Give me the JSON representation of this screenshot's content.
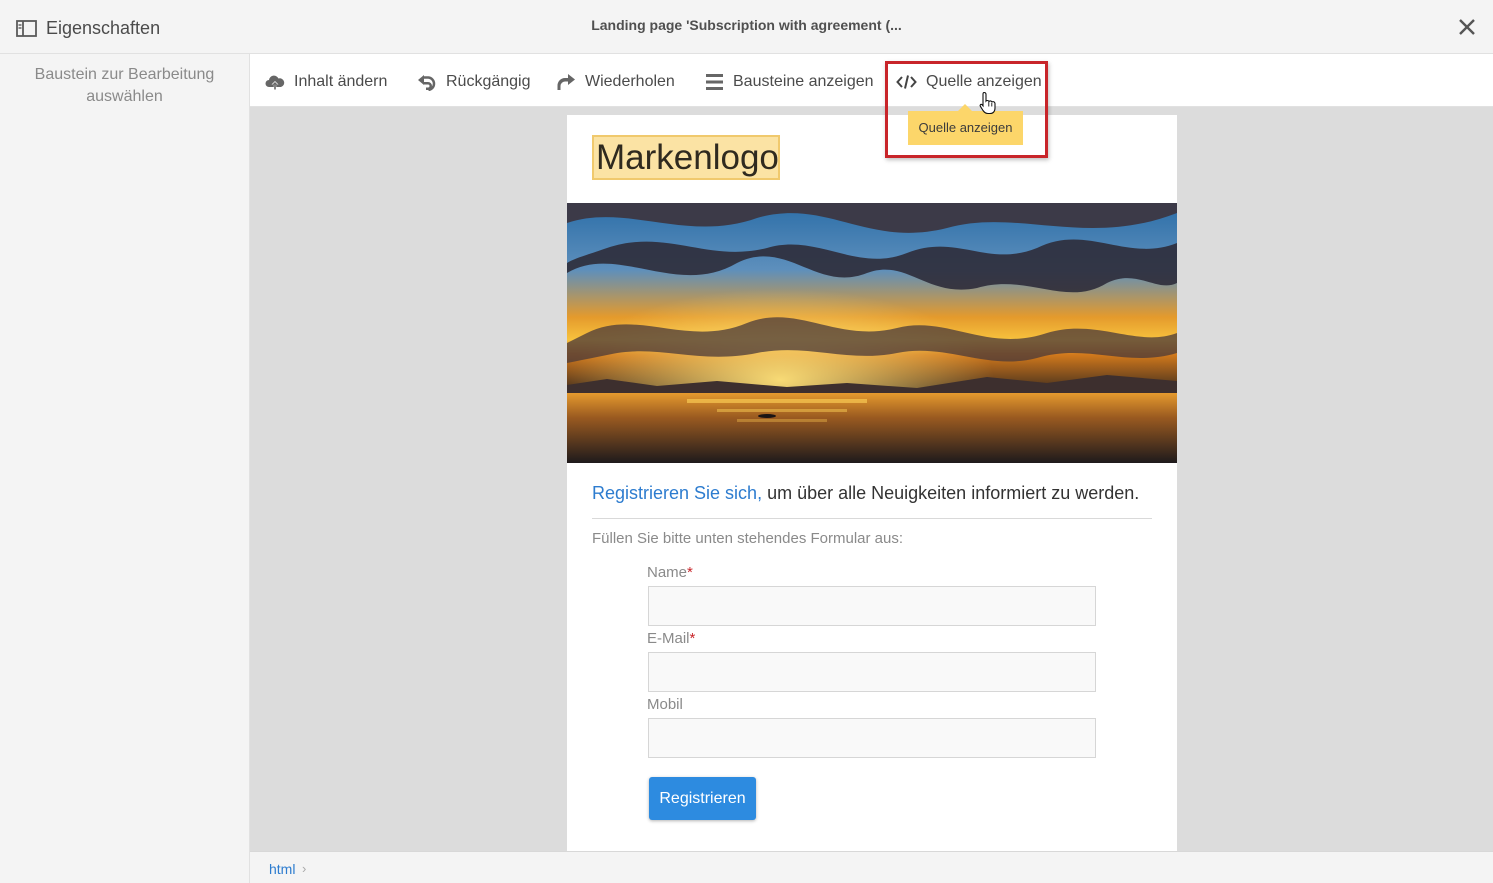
{
  "header": {
    "properties_label": "Eigenschaften",
    "window_title": "Landing page 'Subscription with agreement (..."
  },
  "left_panel": {
    "hint": "Baustein zur Bearbeitung auswählen"
  },
  "toolbar": {
    "change_content": "Inhalt ändern",
    "undo": "Rückgängig",
    "redo": "Wiederholen",
    "show_blocks": "Bausteine anzeigen",
    "show_source": "Quelle anzeigen",
    "tooltip": "Quelle anzeigen"
  },
  "page": {
    "logo": "Markenlogo",
    "headline_accent": "Registrieren Sie sich,",
    "headline_rest": " um über alle Neuigkeiten informiert zu werden.",
    "instruction": "Füllen Sie bitte unten stehendes Formular aus:",
    "fields": [
      {
        "label": "Name",
        "required": "*"
      },
      {
        "label": "E-Mail",
        "required": "*"
      },
      {
        "label": "Mobil",
        "required": ""
      }
    ],
    "submit": "Registrieren"
  },
  "statusbar": {
    "breadcrumb": "html",
    "separator": "›"
  },
  "colors": {
    "accent_blue": "#2d7ccf",
    "highlight_red": "#c8252a",
    "tooltip_yellow": "#fcd66a",
    "button_blue": "#2d8be0"
  },
  "icons": [
    "sidebar-panel-icon",
    "close-icon",
    "cloud-upload-icon",
    "undo-icon",
    "redo-icon",
    "list-icon",
    "code-icon",
    "hand-cursor-icon"
  ]
}
